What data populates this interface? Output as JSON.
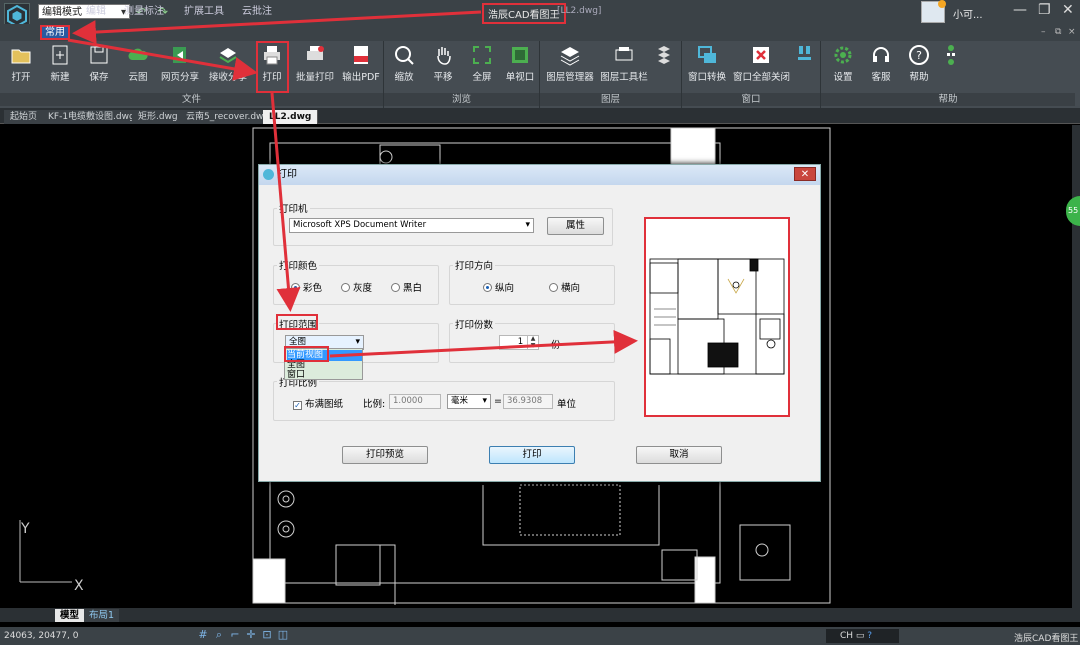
{
  "titlebar": {
    "mode_select": "编辑模式",
    "app_title": "浩辰CAD看图王",
    "document": "[LL2.dwg]",
    "username": "小可..."
  },
  "menubar": {
    "items": [
      "常用",
      "编辑",
      "测量标注",
      "扩展工具",
      "云批注"
    ]
  },
  "ribbon": {
    "buttons": [
      "打开",
      "新建",
      "保存",
      "云图",
      "网页分享",
      "接收分享",
      "打印",
      "批量打印",
      "输出PDF",
      "缩放",
      "平移",
      "全屏",
      "单视口",
      "图层管理器",
      "图层工具栏",
      "窗口转换",
      "窗口全部关闭",
      "设置",
      "客服",
      "帮助"
    ],
    "groups": [
      "文件",
      "浏览",
      "图层",
      "窗口",
      "帮助"
    ]
  },
  "tabs": [
    "起始页",
    "KF-1电缆敷设图.dwg",
    "矩形.dwg",
    "云南5_recover.dwg",
    "LL2.dwg"
  ],
  "layout_tabs": [
    "模型",
    "布局1"
  ],
  "status": {
    "coords": "24063, 20477, 0",
    "ime": "CH",
    "app_name": "浩辰CAD看图王",
    "side_badge": "55"
  },
  "axes": {
    "y": "Y",
    "x": "X"
  },
  "dialog": {
    "title": "打印",
    "printer_group": "打印机",
    "printer_value": "Microsoft XPS Document Writer",
    "properties_button": "属性",
    "color_group": "打印颜色",
    "color_options": [
      "彩色",
      "灰度",
      "黑白"
    ],
    "orientation_group": "打印方向",
    "orientation_options": [
      "纵向",
      "横向"
    ],
    "range_group": "打印范围",
    "range_value": "全图",
    "range_options": [
      "当前视图",
      "全图",
      "窗口"
    ],
    "copies_group": "打印份数",
    "copies_value": "1",
    "copies_unit": "份",
    "scale_group": "打印比例",
    "fit_paper": "布满图纸",
    "scale_label": "比例:",
    "scale_value": "1.0000",
    "scale_unit": "毫米",
    "equals": "=",
    "scale_result": "36.9308",
    "unit_label": "单位",
    "preview_button": "打印预览",
    "print_button": "打印",
    "cancel_button": "取消"
  }
}
